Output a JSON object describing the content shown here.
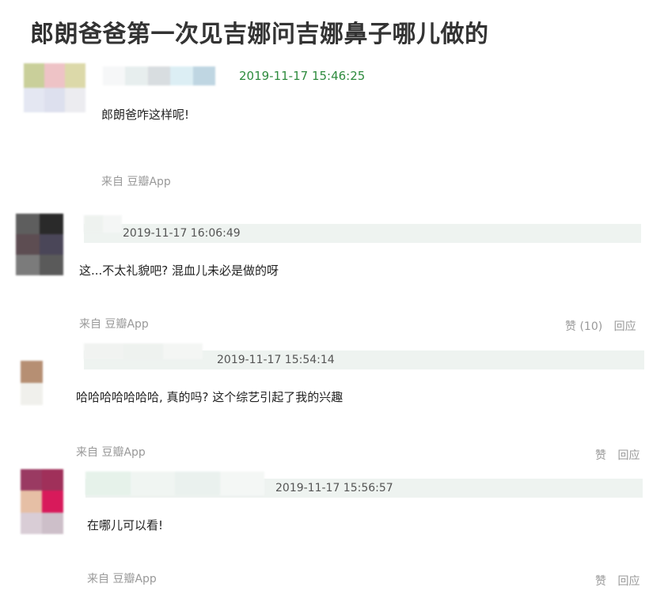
{
  "page": {
    "title": "郎朗爸爸第一次见吉娜问吉娜鼻子哪儿做的"
  },
  "colors": {
    "timestamp_first": "#2e8b3e",
    "timestamp_other": "#555555",
    "meta_bar": "#eef3f0",
    "muted": "#999999"
  },
  "comments": [
    {
      "timestamp": "2019-11-17 15:46:25",
      "text": "郎朗爸咋这样呢!",
      "source": "来自 豆瓣App",
      "like_label": "",
      "reply_label": ""
    },
    {
      "timestamp": "2019-11-17 16:06:49",
      "text": "这...不太礼貌吧? 混血儿未必是做的呀",
      "source": "来自 豆瓣App",
      "like_label": "赞 (10)",
      "reply_label": "回应"
    },
    {
      "timestamp": "2019-11-17 15:54:14",
      "text": "哈哈哈哈哈哈哈, 真的吗? 这个综艺引起了我的兴趣",
      "source": "来自 豆瓣App",
      "like_label": "赞",
      "reply_label": "回应"
    },
    {
      "timestamp": "2019-11-17 15:56:57",
      "text": "在哪儿可以看!",
      "source": "来自 豆瓣App",
      "like_label": "赞",
      "reply_label": "回应"
    }
  ]
}
